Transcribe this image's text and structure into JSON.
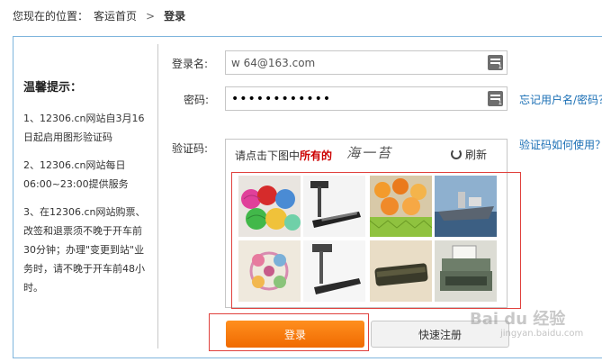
{
  "breadcrumb": {
    "prefix": "您现在的位置：",
    "home": "客运首页",
    "separator": ">",
    "current": "登录"
  },
  "tips": {
    "title": "温馨提示：",
    "items": [
      "1、12306.cn网站自3月16日起启用图形验证码",
      "2、12306.cn网站每日06:00~23:00提供服务",
      "3、在12306.cn网站购票、改签和退票须不晚于开车前30分钟；办理\"变更到站\"业务时，请不晚于开车前48小时。"
    ]
  },
  "form": {
    "username_label": "登录名:",
    "username_value": "w      64@163.com",
    "password_label": "密码:",
    "password_value": "••••••••••••",
    "captcha_label": "验证码:",
    "keyboard_badge": "1",
    "forgot_link": "忘记用户名/密码？",
    "captcha_help_link": "验证码如何使用？"
  },
  "captcha": {
    "prompt_prefix": "请点击下图中",
    "prompt_emphasis": "所有的",
    "prompt_word": "海一苔",
    "refresh_label": "刷新",
    "tiles": [
      "yarn-balls",
      "treadmill",
      "jelly-candies",
      "ship-at-sea",
      "embroidery",
      "treadmill",
      "seaweed-snack",
      "typewriter"
    ]
  },
  "buttons": {
    "login": "登录",
    "register": "快速注册"
  },
  "watermark": {
    "brand": "Bai du 经验",
    "sub": "jingyan.baidu.com"
  },
  "colors": {
    "link": "#1a6fb5",
    "login_orange": "#f57a0a",
    "highlight_red": "#e0403c"
  }
}
